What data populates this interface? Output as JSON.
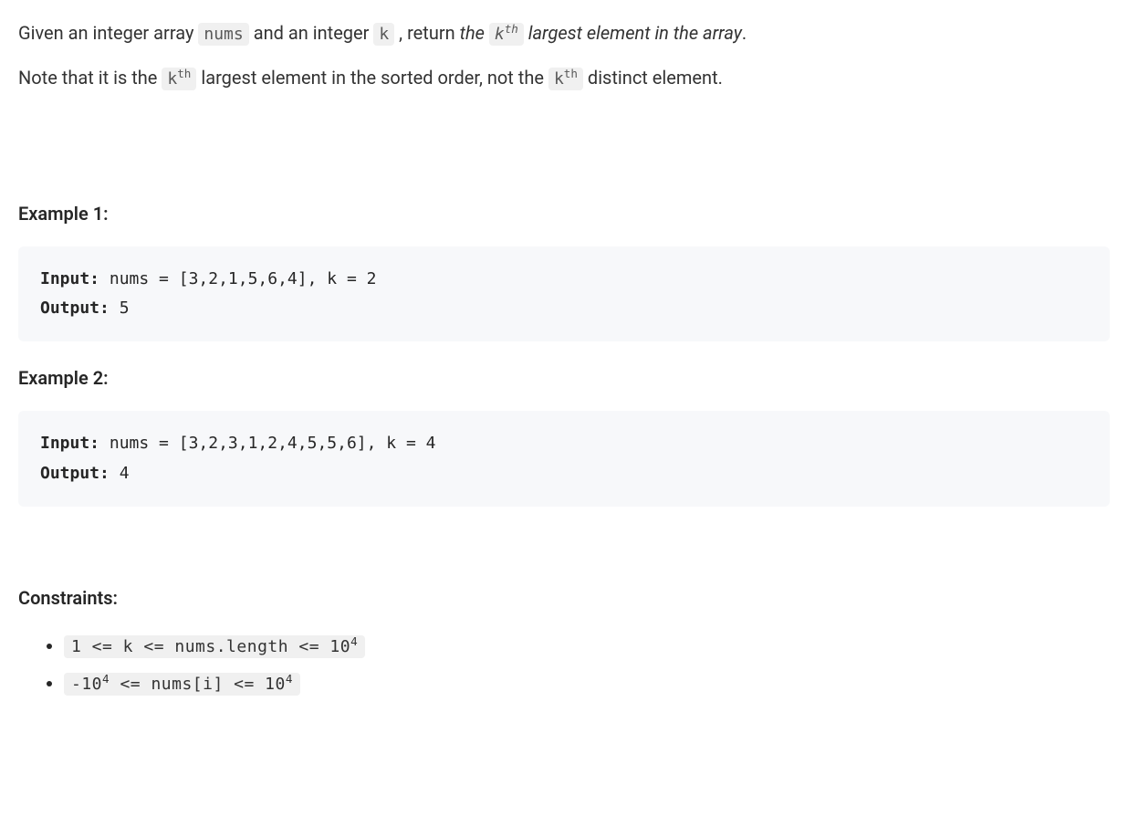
{
  "description": {
    "p1_part1": "Given an integer array ",
    "p1_code1": "nums",
    "p1_part2": " and an integer ",
    "p1_code2": "k",
    "p1_part3": " , return ",
    "p1_italic1": "the ",
    "p1_code3_base": "k",
    "p1_code3_sup": "th",
    "p1_italic2": " largest element in the array",
    "p1_part4": ".",
    "p2_part1": "Note that it is the ",
    "p2_code1_base": "k",
    "p2_code1_sup": "th",
    "p2_part2": " largest element in the sorted order, not the ",
    "p2_code2_base": "k",
    "p2_code2_sup": "th",
    "p2_part3": " distinct element."
  },
  "examples": {
    "heading1": "Example 1:",
    "ex1_input_label": "Input:",
    "ex1_input_value": " nums = [3,2,1,5,6,4], k = 2",
    "ex1_output_label": "Output:",
    "ex1_output_value": " 5",
    "heading2": "Example 2:",
    "ex2_input_label": "Input:",
    "ex2_input_value": " nums = [3,2,3,1,2,4,5,5,6], k = 4",
    "ex2_output_label": "Output:",
    "ex2_output_value": " 4"
  },
  "constraints": {
    "heading": "Constraints:",
    "c1_part1": "1 <= k <= nums.length <= 10",
    "c1_sup": "4",
    "c2_part1": "-10",
    "c2_sup1": "4",
    "c2_part2": " <= nums[i] <= 10",
    "c2_sup2": "4"
  }
}
